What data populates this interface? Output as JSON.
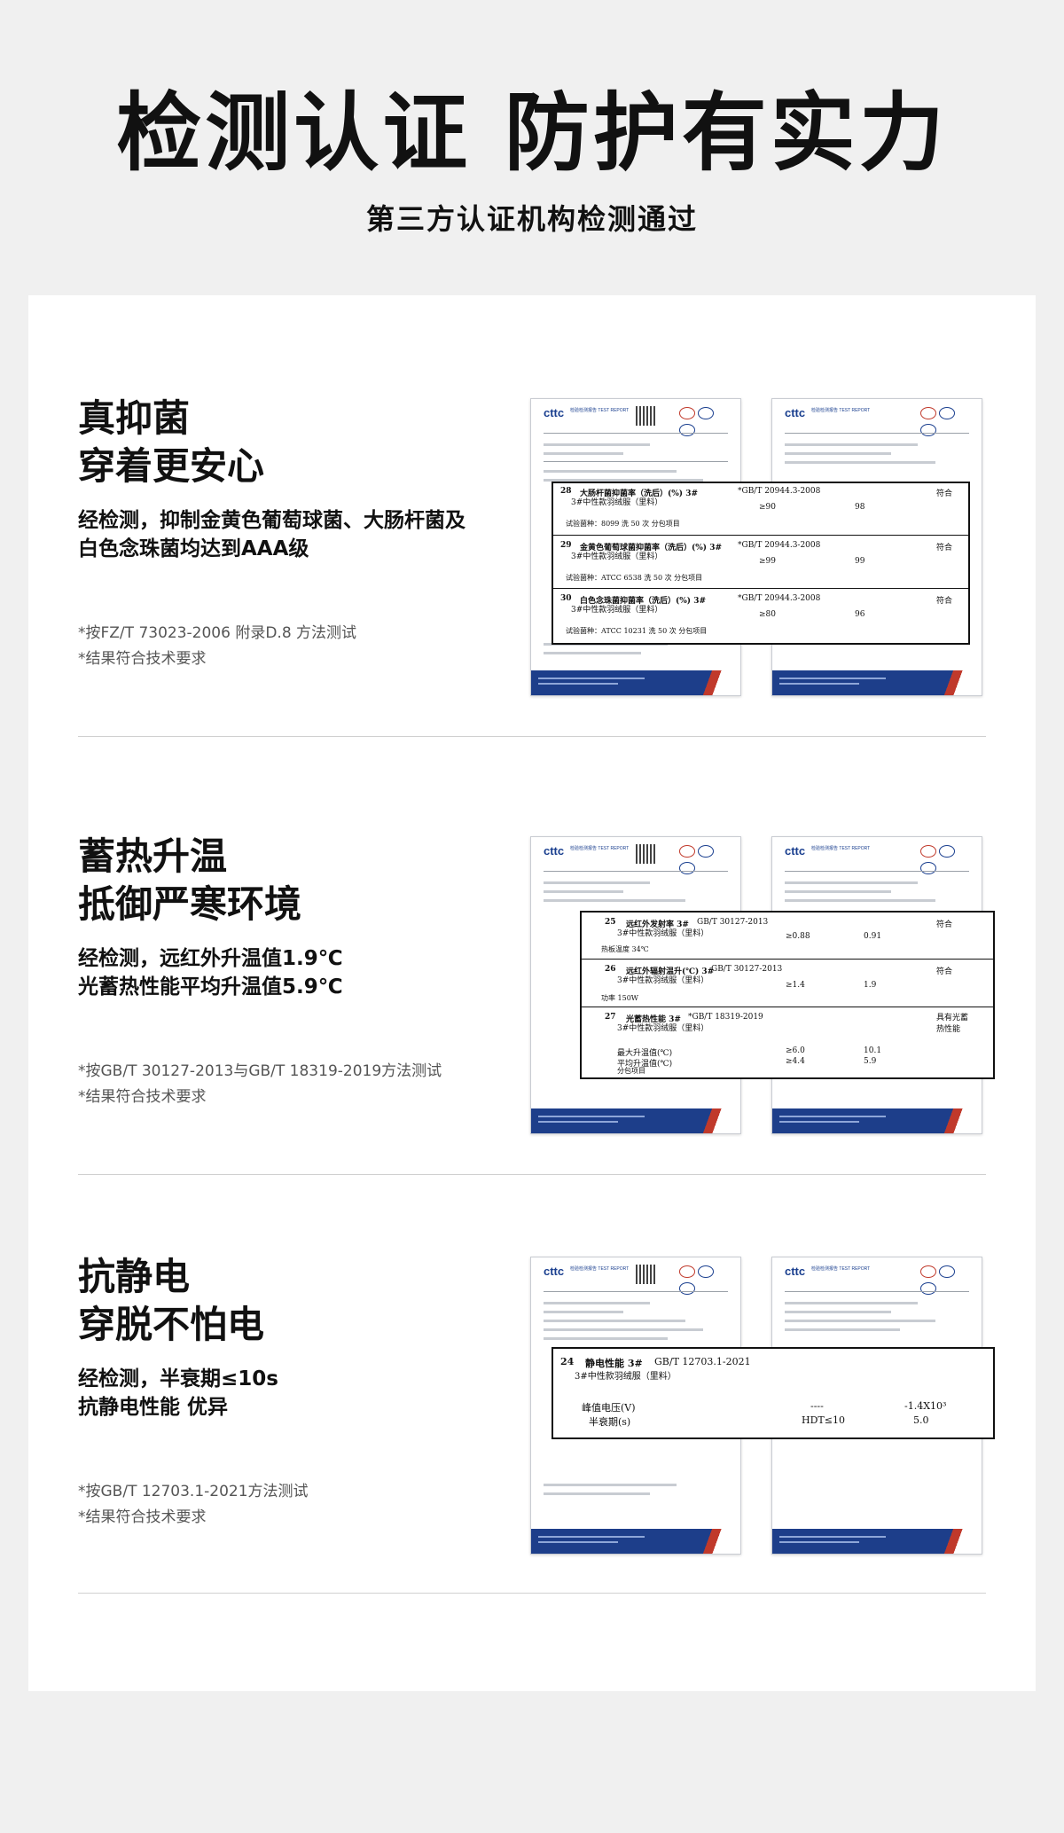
{
  "header": {
    "title": "检测认证 防护有实力",
    "subtitle": "第三方认证机构检测通过"
  },
  "sections": [
    {
      "title_line1": "真抑菌",
      "title_line2": "穿着更安心",
      "desc_line1": "经检测，抑制金黄色葡萄球菌、大肠杆菌及",
      "desc_line2": "白色念珠菌均达到AAA级",
      "note_line1": "*按FZ/T 73023-2006 附录D.8 方法测试",
      "note_line2": "*结果符合技术要求",
      "table": [
        {
          "no": "28",
          "item": "大肠杆菌抑菌率（洗后）(%) 3#",
          "std": "*GB/T 20944.3-2008",
          "sub": "3#中性款羽绒服（里料）",
          "req": "≥90",
          "result": "98",
          "judge": "符合",
          "cond": "试验菌种：8099 洗 50 次   分包项目"
        },
        {
          "no": "29",
          "item": "金黄色葡萄球菌抑菌率（洗后）(%) 3#",
          "std": "*GB/T 20944.3-2008",
          "sub": "3#中性款羽绒服（里料）",
          "req": "≥99",
          "result": "99",
          "judge": "符合",
          "cond": "试验菌种：ATCC 6538 洗 50 次   分包项目"
        },
        {
          "no": "30",
          "item": "白色念珠菌抑菌率（洗后）(%) 3#",
          "std": "*GB/T 20944.3-2008",
          "sub": "3#中性款羽绒服（里料）",
          "req": "≥80",
          "result": "96",
          "judge": "符合",
          "cond": "试验菌种：ATCC 10231 洗 50 次   分包项目"
        }
      ]
    },
    {
      "title_line1": "蓄热升温",
      "title_line2": "抵御严寒环境",
      "desc_line1": "经检测，远红外升温值1.9℃",
      "desc_line2": "光蓄热性能平均升温值5.9℃",
      "note_line1": "*按GB/T 30127-2013与GB/T 18319-2019方法测试",
      "note_line2": "*结果符合技术要求",
      "table": [
        {
          "no": "25",
          "item": "远红外发射率 3#",
          "std": "GB/T 30127-2013",
          "sub": "3#中性款羽绒服（里料）",
          "req": "≥0.88",
          "result": "0.91",
          "judge": "符合",
          "cond": "热板温度 34℃"
        },
        {
          "no": "26",
          "item": "远红外辐射温升(℃) 3#",
          "std": "GB/T 30127-2013",
          "sub": "3#中性款羽绒服（里料）",
          "req": "≥1.4",
          "result": "1.9",
          "judge": "符合",
          "cond": "功率 150W"
        },
        {
          "no": "27",
          "item": "光蓄热性能 3#",
          "std": "*GB/T 18319-2019",
          "sub": "3#中性款羽绒服（里料）",
          "judge": "具有光蓄热性能",
          "r1_label": "最大升温值(℃)",
          "r1_req": "≥6.0",
          "r1_res": "10.1",
          "r2_label": "平均升温值(℃)",
          "r2_req": "≥4.4",
          "r2_res": "5.9",
          "cond": "分包项目"
        }
      ]
    },
    {
      "title_line1": "抗静电",
      "title_line2": "穿脱不怕电",
      "desc_line1": "经检测，半衰期≤10s",
      "desc_line2": "抗静电性能 优异",
      "note_line1": "*按GB/T 12703.1-2021方法测试",
      "note_line2": "*结果符合技术要求",
      "table": [
        {
          "no": "24",
          "item": "静电性能 3#",
          "std": "GB/T 12703.1-2021",
          "sub": "3#中性款羽绒服（里料）",
          "r1_label": "峰值电压(V)",
          "r1_req": "----",
          "r1_res": "-1.4X10³",
          "r2_label": "半衰期(s)",
          "r2_req": "HDT≤10",
          "r2_res": "5.0"
        }
      ]
    }
  ],
  "doc_logo": "cttc",
  "doc_logo_sub": "检验检测报告 TEST REPORT"
}
